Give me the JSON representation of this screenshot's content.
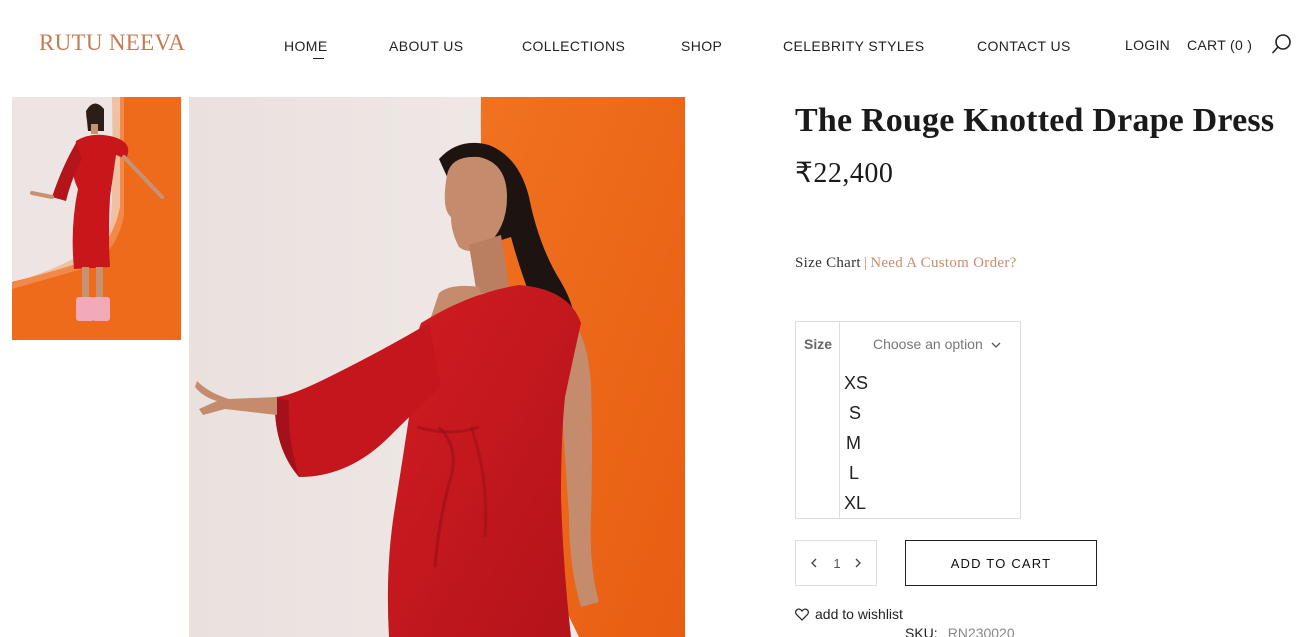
{
  "brand": {
    "logo_text": "RUTU NEEVA",
    "color": "#c47a52"
  },
  "nav": {
    "items": [
      {
        "label": "HOME",
        "active": true
      },
      {
        "label": "ABOUT US"
      },
      {
        "label": "COLLECTIONS"
      },
      {
        "label": "SHOP"
      },
      {
        "label": "CELEBRITY STYLES"
      },
      {
        "label": "CONTACT US"
      }
    ],
    "login_label": "LOGIN",
    "cart_label": "CART (0 )",
    "search_icon": "search-icon"
  },
  "gallery": {
    "thumbnail_alt": "red dress full length",
    "main_alt": "red dress model",
    "colors": {
      "backdrop_light": "#ece6e4",
      "backdrop_orange": "#ee6a1a",
      "dress": "#c8161b"
    }
  },
  "product": {
    "title": "The Rouge Knotted Drape Dress",
    "price": "₹22,400",
    "size_chart_label": "Size Chart",
    "separator": "|",
    "custom_order_label": "Need A Custom Order?",
    "size": {
      "label": "Size",
      "placeholder": "Choose an option",
      "options": [
        "XS",
        "S",
        "M",
        "L",
        "XL"
      ]
    },
    "quantity": "1",
    "add_to_cart_label": "ADD TO CART",
    "wishlist_label": "add to wishlist",
    "sku_label": "SKU:",
    "sku_value": "RN230020"
  }
}
